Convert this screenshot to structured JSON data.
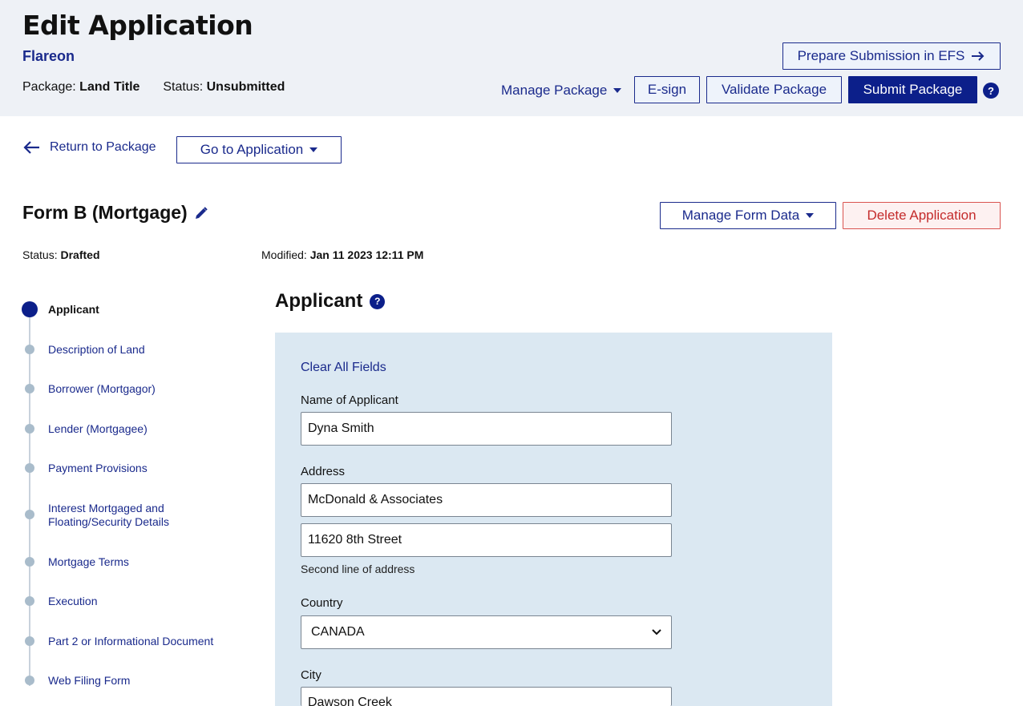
{
  "header": {
    "title": "Edit Application",
    "organization": "Flareon",
    "package_label": "Package:",
    "package_value": "Land Title",
    "status_label": "Status:",
    "status_value": "Unsubmitted",
    "prepare_button": "Prepare Submission in EFS",
    "manage_package": "Manage Package",
    "esign_button": "E-sign",
    "validate_button": "Validate Package",
    "submit_button": "Submit Package",
    "help": "?"
  },
  "nav": {
    "return_label": "Return to Package",
    "go_to_application": "Go to Application"
  },
  "form": {
    "title": "Form B (Mortgage)",
    "manage_form_data": "Manage Form Data",
    "delete_application": "Delete Application",
    "status_label": "Status:",
    "status_value": "Drafted",
    "modified_label": "Modified:",
    "modified_value": "Jan 11 2023 12:11 PM"
  },
  "steps": [
    {
      "label": "Applicant",
      "active": true
    },
    {
      "label": "Description of Land"
    },
    {
      "label": "Borrower (Mortgagor)"
    },
    {
      "label": "Lender (Mortgagee)"
    },
    {
      "label": "Payment Provisions"
    },
    {
      "label": "Interest Mortgaged and Floating/Security Details"
    },
    {
      "label": "Mortgage Terms"
    },
    {
      "label": "Execution"
    },
    {
      "label": "Part 2 or Informational Document"
    },
    {
      "label": "Web Filing Form"
    }
  ],
  "applicant": {
    "section_title": "Applicant",
    "help": "?",
    "clear_all": "Clear All Fields",
    "name_label": "Name of Applicant",
    "name_value": "Dyna Smith",
    "address_label": "Address",
    "address_line1": "McDonald & Associates",
    "address_line2": "11620 8th Street",
    "address_hint": "Second line of address",
    "country_label": "Country",
    "country_value": "CANADA",
    "city_label": "City",
    "city_value": "Dawson Creek"
  },
  "colors": {
    "primary": "#0c1f8a",
    "header_bg": "#eef1f6",
    "panel_bg": "#dbe8f2",
    "danger": "#c42b2b"
  }
}
